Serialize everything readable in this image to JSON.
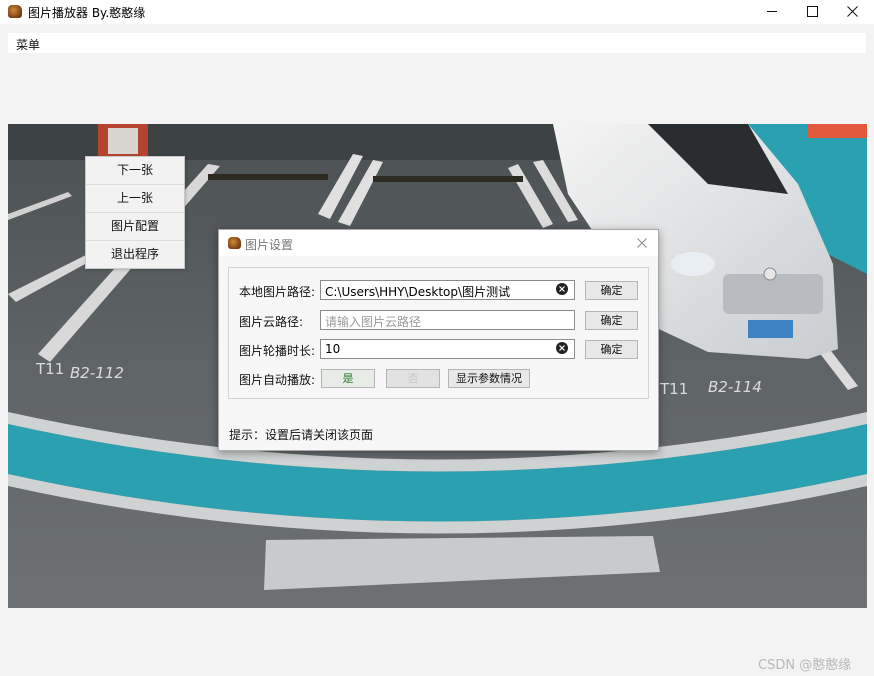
{
  "window": {
    "title": "图片播放器 By.憨憨缘",
    "icon": "app-icon",
    "controls": [
      "minimize-icon",
      "maximize-icon",
      "close-icon"
    ]
  },
  "menubar": {
    "label": "菜单"
  },
  "context_menu": {
    "items": [
      {
        "label": "下一张"
      },
      {
        "label": "上一张"
      },
      {
        "label": "图片配置"
      },
      {
        "label": "退出程序"
      }
    ]
  },
  "photo": {
    "labels": [
      "T11",
      "B2-112",
      "T11",
      "B2-114"
    ]
  },
  "dialog": {
    "title": "图片设置",
    "rows": [
      {
        "label": "本地图片路径:",
        "value": "C:\\Users\\HHY\\Desktop\\图片测试",
        "placeholder": "",
        "button": "确定"
      },
      {
        "label": "图片云路径:",
        "value": "",
        "placeholder": "请输入图片云路径",
        "button": "确定"
      },
      {
        "label": "图片轮播时长:",
        "value": "10",
        "placeholder": "",
        "button": "确定"
      }
    ],
    "autoplay": {
      "label": "图片自动播放:",
      "yes": "是",
      "no": "否",
      "show_params": "显示参数情况"
    },
    "hint": "提示：设置后请关闭该页面"
  },
  "watermark": "CSDN @憨憨缘",
  "colors": {
    "teal": "#2aa0b0",
    "accent_yes": "#2a7a2a"
  }
}
